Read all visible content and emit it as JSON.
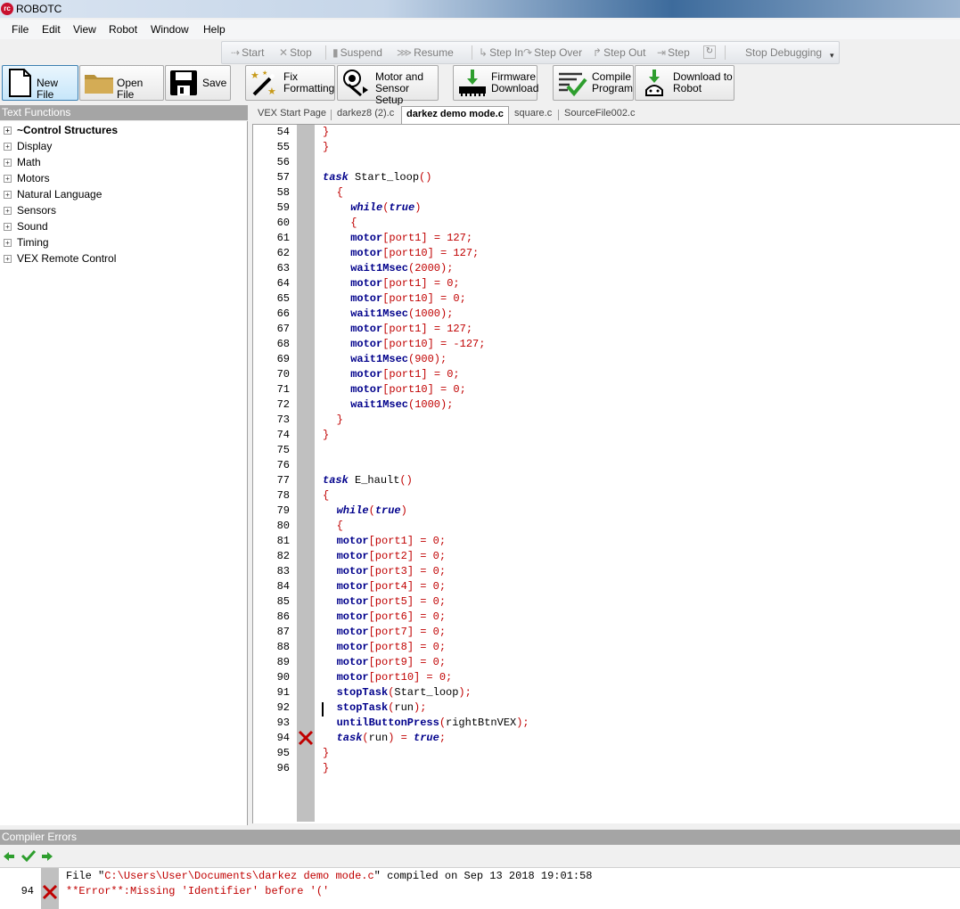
{
  "window": {
    "title": "ROBOTC",
    "logo_text": "rc"
  },
  "menu": [
    "File",
    "Edit",
    "View",
    "Robot",
    "Window",
    "Help"
  ],
  "debug_toolbar": {
    "start": "Start",
    "stop": "Stop",
    "suspend": "Suspend",
    "resume": "Resume",
    "step_in": "Step In",
    "step_over": "Step Over",
    "step_out": "Step Out",
    "step": "Step",
    "stop_debugging": "Stop Debugging"
  },
  "toolbar": {
    "new_file": "New File",
    "open_file": "Open File",
    "save": "Save",
    "fix_formatting_1": "Fix",
    "fix_formatting_2": "Formatting",
    "motor_setup_1": "Motor and",
    "motor_setup_2": "Sensor Setup",
    "firmware_1": "Firmware",
    "firmware_2": "Download",
    "compile_1": "Compile",
    "compile_2": "Program",
    "download_1": "Download to",
    "download_2": "Robot"
  },
  "text_functions": {
    "header": "Text Functions",
    "items": [
      "~Control Structures",
      "Display",
      "Math",
      "Motors",
      "Natural Language",
      "Sensors",
      "Sound",
      "Timing",
      "VEX Remote Control"
    ]
  },
  "tabs": [
    "VEX Start Page",
    "darkez8 (2).c",
    "darkez demo mode.c",
    "square.c",
    "SourceFile002.c"
  ],
  "active_tab": "darkez demo mode.c",
  "code_lines": [
    {
      "n": "54",
      "code": [
        [
          "}",
          "rd"
        ]
      ],
      "indent": 0
    },
    {
      "n": "55",
      "code": [
        [
          "}",
          "rd"
        ]
      ],
      "indent": 0
    },
    {
      "n": "56",
      "code": [],
      "indent": 0
    },
    {
      "n": "57",
      "code": [
        [
          "task",
          "kw"
        ],
        [
          " Start_loop",
          "pl"
        ],
        [
          "()",
          "rd"
        ]
      ],
      "indent": 0
    },
    {
      "n": "58",
      "code": [
        [
          "{",
          "rd"
        ]
      ],
      "indent": 2
    },
    {
      "n": "59",
      "code": [
        [
          "while",
          "kw"
        ],
        [
          "(",
          "rd"
        ],
        [
          "true",
          "kw"
        ],
        [
          ")",
          "rd"
        ]
      ],
      "indent": 4
    },
    {
      "n": "60",
      "code": [
        [
          "{",
          "rd"
        ]
      ],
      "indent": 4
    },
    {
      "n": "61",
      "code": [
        [
          "motor",
          "fn"
        ],
        [
          "[port1] = 127;",
          "rd"
        ]
      ],
      "indent": 4
    },
    {
      "n": "62",
      "code": [
        [
          "motor",
          "fn"
        ],
        [
          "[port10] = 127;",
          "rd"
        ]
      ],
      "indent": 4
    },
    {
      "n": "63",
      "code": [
        [
          "wait1Msec",
          "fn"
        ],
        [
          "(2000);",
          "rd"
        ]
      ],
      "indent": 4
    },
    {
      "n": "64",
      "code": [
        [
          "motor",
          "fn"
        ],
        [
          "[port1] = 0;",
          "rd"
        ]
      ],
      "indent": 4
    },
    {
      "n": "65",
      "code": [
        [
          "motor",
          "fn"
        ],
        [
          "[port10] = 0;",
          "rd"
        ]
      ],
      "indent": 4
    },
    {
      "n": "66",
      "code": [
        [
          "wait1Msec",
          "fn"
        ],
        [
          "(1000);",
          "rd"
        ]
      ],
      "indent": 4
    },
    {
      "n": "67",
      "code": [
        [
          "motor",
          "fn"
        ],
        [
          "[port1] = 127;",
          "rd"
        ]
      ],
      "indent": 4
    },
    {
      "n": "68",
      "code": [
        [
          "motor",
          "fn"
        ],
        [
          "[port10] = -127;",
          "rd"
        ]
      ],
      "indent": 4
    },
    {
      "n": "69",
      "code": [
        [
          "wait1Msec",
          "fn"
        ],
        [
          "(900);",
          "rd"
        ]
      ],
      "indent": 4
    },
    {
      "n": "70",
      "code": [
        [
          "motor",
          "fn"
        ],
        [
          "[port1] = 0;",
          "rd"
        ]
      ],
      "indent": 4
    },
    {
      "n": "71",
      "code": [
        [
          "motor",
          "fn"
        ],
        [
          "[port10] = 0;",
          "rd"
        ]
      ],
      "indent": 4
    },
    {
      "n": "72",
      "code": [
        [
          "wait1Msec",
          "fn"
        ],
        [
          "(1000);",
          "rd"
        ]
      ],
      "indent": 4
    },
    {
      "n": "73",
      "code": [
        [
          "}",
          "rd"
        ]
      ],
      "indent": 2
    },
    {
      "n": "74",
      "code": [
        [
          "}",
          "rd"
        ]
      ],
      "indent": 0
    },
    {
      "n": "75",
      "code": [],
      "indent": 0
    },
    {
      "n": "76",
      "code": [],
      "indent": 0
    },
    {
      "n": "77",
      "code": [
        [
          "task",
          "kw"
        ],
        [
          " E_hault",
          "pl"
        ],
        [
          "()",
          "rd"
        ]
      ],
      "indent": 0
    },
    {
      "n": "78",
      "code": [
        [
          "{",
          "rd"
        ]
      ],
      "indent": 0
    },
    {
      "n": "79",
      "code": [
        [
          "while",
          "kw"
        ],
        [
          "(",
          "rd"
        ],
        [
          "true",
          "kw"
        ],
        [
          ")",
          "rd"
        ]
      ],
      "indent": 2
    },
    {
      "n": "80",
      "code": [
        [
          "{",
          "rd"
        ]
      ],
      "indent": 2
    },
    {
      "n": "81",
      "code": [
        [
          "motor",
          "fn"
        ],
        [
          "[port1] = 0;",
          "rd"
        ]
      ],
      "indent": 2
    },
    {
      "n": "82",
      "code": [
        [
          "motor",
          "fn"
        ],
        [
          "[port2] = 0;",
          "rd"
        ]
      ],
      "indent": 2
    },
    {
      "n": "83",
      "code": [
        [
          "motor",
          "fn"
        ],
        [
          "[port3] = 0;",
          "rd"
        ]
      ],
      "indent": 2
    },
    {
      "n": "84",
      "code": [
        [
          "motor",
          "fn"
        ],
        [
          "[port4] = 0;",
          "rd"
        ]
      ],
      "indent": 2
    },
    {
      "n": "85",
      "code": [
        [
          "motor",
          "fn"
        ],
        [
          "[port5] = 0;",
          "rd"
        ]
      ],
      "indent": 2
    },
    {
      "n": "86",
      "code": [
        [
          "motor",
          "fn"
        ],
        [
          "[port6] = 0;",
          "rd"
        ]
      ],
      "indent": 2
    },
    {
      "n": "87",
      "code": [
        [
          "motor",
          "fn"
        ],
        [
          "[port7] = 0;",
          "rd"
        ]
      ],
      "indent": 2
    },
    {
      "n": "88",
      "code": [
        [
          "motor",
          "fn"
        ],
        [
          "[port8] = 0;",
          "rd"
        ]
      ],
      "indent": 2
    },
    {
      "n": "89",
      "code": [
        [
          "motor",
          "fn"
        ],
        [
          "[port9] = 0;",
          "rd"
        ]
      ],
      "indent": 2
    },
    {
      "n": "90",
      "code": [
        [
          "motor",
          "fn"
        ],
        [
          "[port10] = 0;",
          "rd"
        ]
      ],
      "indent": 2
    },
    {
      "n": "91",
      "code": [
        [
          "stopTask",
          "fn"
        ],
        [
          "(",
          "rd"
        ],
        [
          "Start_loop",
          "pl"
        ],
        [
          ");",
          "rd"
        ]
      ],
      "indent": 2
    },
    {
      "n": "92",
      "code": [
        [
          "stopTask",
          "fn"
        ],
        [
          "(",
          "rd"
        ],
        [
          "run",
          "pl"
        ],
        [
          ");",
          "rd"
        ]
      ],
      "indent": 2
    },
    {
      "n": "93",
      "code": [
        [
          "untilButtonPress",
          "fn"
        ],
        [
          "(",
          "rd"
        ],
        [
          "rightBtnVEX",
          "pl"
        ],
        [
          ");",
          "rd"
        ]
      ],
      "indent": 2
    },
    {
      "n": "94",
      "code": [
        [
          "task",
          "kw"
        ],
        [
          "(",
          "rd"
        ],
        [
          "run",
          "pl"
        ],
        [
          ") = ",
          "rd"
        ],
        [
          "true",
          "kw"
        ],
        [
          ";",
          "rd"
        ]
      ],
      "indent": 2,
      "error": true
    },
    {
      "n": "95",
      "code": [
        [
          "}",
          "rd"
        ]
      ],
      "indent": 0
    },
    {
      "n": "96",
      "code": [
        [
          "}",
          "rd"
        ]
      ],
      "indent": 0
    }
  ],
  "compiler_errors": {
    "header": "Compiler Errors",
    "file_line": {
      "prefix": "File \"",
      "path": "C:\\Users\\User\\Documents\\darkez demo mode.c",
      "suffix": "\" compiled on Sep 13 2018 19:01:58"
    },
    "error": {
      "line": "94",
      "message": "**Error**:Missing 'Identifier' before '('"
    }
  },
  "colors": {
    "keyword": "#00008b",
    "symbol": "#c00000",
    "error": "#c00000",
    "panel_header": "#a5a5a5"
  }
}
